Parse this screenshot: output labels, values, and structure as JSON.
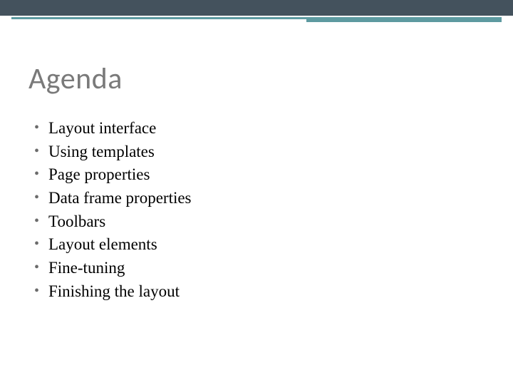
{
  "slide": {
    "title": "Agenda",
    "bullets": [
      "Layout interface",
      "Using templates",
      "Page properties",
      "Data frame properties",
      "Toolbars",
      "Layout elements",
      "Fine-tuning",
      "Finishing the layout"
    ]
  }
}
